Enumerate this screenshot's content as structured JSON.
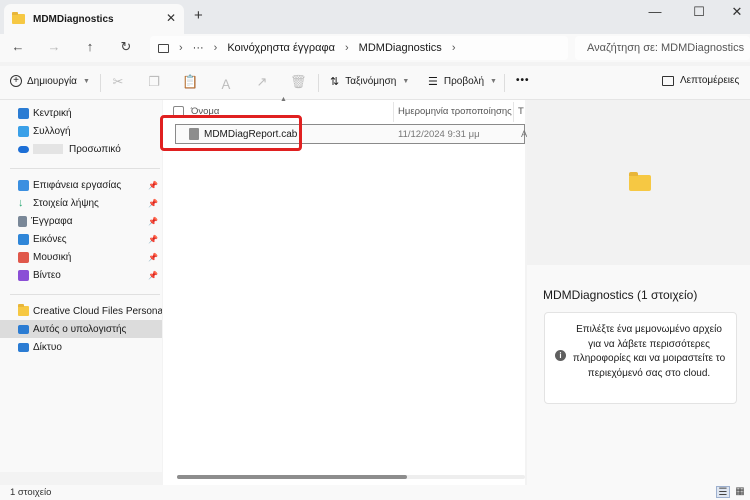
{
  "tab": {
    "title": "MDMDiagnostics",
    "close": "✕",
    "new": "+"
  },
  "window": {
    "minimize": "—",
    "maximize": "☐",
    "close": "✕"
  },
  "nav": {
    "back": "←",
    "forward": "→",
    "up": "↑",
    "refresh": "↻",
    "more": "···"
  },
  "address": {
    "segments": [
      "Κοινόχρηστα έγγραφα",
      "MDMDiagnostics"
    ],
    "sep": "›"
  },
  "search": {
    "placeholder": "Αναζήτηση σε: MDMDiagnostics"
  },
  "commandbar": {
    "new_label": "Δημιουργία",
    "sort_label": "Ταξινόμηση",
    "view_label": "Προβολή",
    "more": "•••",
    "details_label": "Λεπτομέρειες"
  },
  "sidebar": {
    "top": [
      {
        "label": "Κεντρική",
        "icon": "home-icon",
        "color": "#2b7cd3"
      },
      {
        "label": "Συλλογή",
        "icon": "gallery-icon",
        "color": "#3aa0e8"
      },
      {
        "label": "Προσωπικό",
        "icon": "onedrive-icon",
        "color": "#1d6fd6"
      }
    ],
    "quick": [
      {
        "label": "Επιφάνεια εργασίας",
        "icon": "desktop-icon",
        "color": "#3b8fe0"
      },
      {
        "label": "Στοιχεία λήψης",
        "icon": "download-icon",
        "color": "#2aa873"
      },
      {
        "label": "Έγγραφα",
        "icon": "documents-icon",
        "color": "#7a8898"
      },
      {
        "label": "Εικόνες",
        "icon": "pictures-icon",
        "color": "#2f86d8"
      },
      {
        "label": "Μουσική",
        "icon": "music-icon",
        "color": "#e0584b"
      },
      {
        "label": "Βίντεο",
        "icon": "video-icon",
        "color": "#8b4fd6"
      }
    ],
    "bottom": [
      {
        "label": "Creative Cloud Files Personal Acc",
        "icon": "creative-cloud-icon",
        "color": "#f6c843"
      },
      {
        "label": "Αυτός ο υπολογιστής",
        "icon": "computer-icon",
        "color": "#2b7cd3"
      },
      {
        "label": "Δίκτυο",
        "icon": "network-icon",
        "color": "#2b7cd3"
      }
    ]
  },
  "filelist": {
    "columns": {
      "name": "Όνομα",
      "date": "Ημερομηνία τροποποίησης",
      "type": "Τ"
    },
    "rows": [
      {
        "name": "MDMDiagReport.cab",
        "date": "11/12/2024 9:31 μμ",
        "type": "Α"
      }
    ]
  },
  "preview": {
    "title": "MDMDiagnostics (1 στοιχείο)",
    "info": "Επιλέξτε ένα μεμονωμένο αρχείο για να λάβετε περισσότερες πληροφορίες και να μοιραστείτε το περιεχόμενό σας στο cloud.",
    "info_icon": "i"
  },
  "status": {
    "count": "1 στοιχείο"
  },
  "colors": {
    "folder": "#f6c843",
    "highlight": "#e02020",
    "selected": "#dcdcdc"
  }
}
